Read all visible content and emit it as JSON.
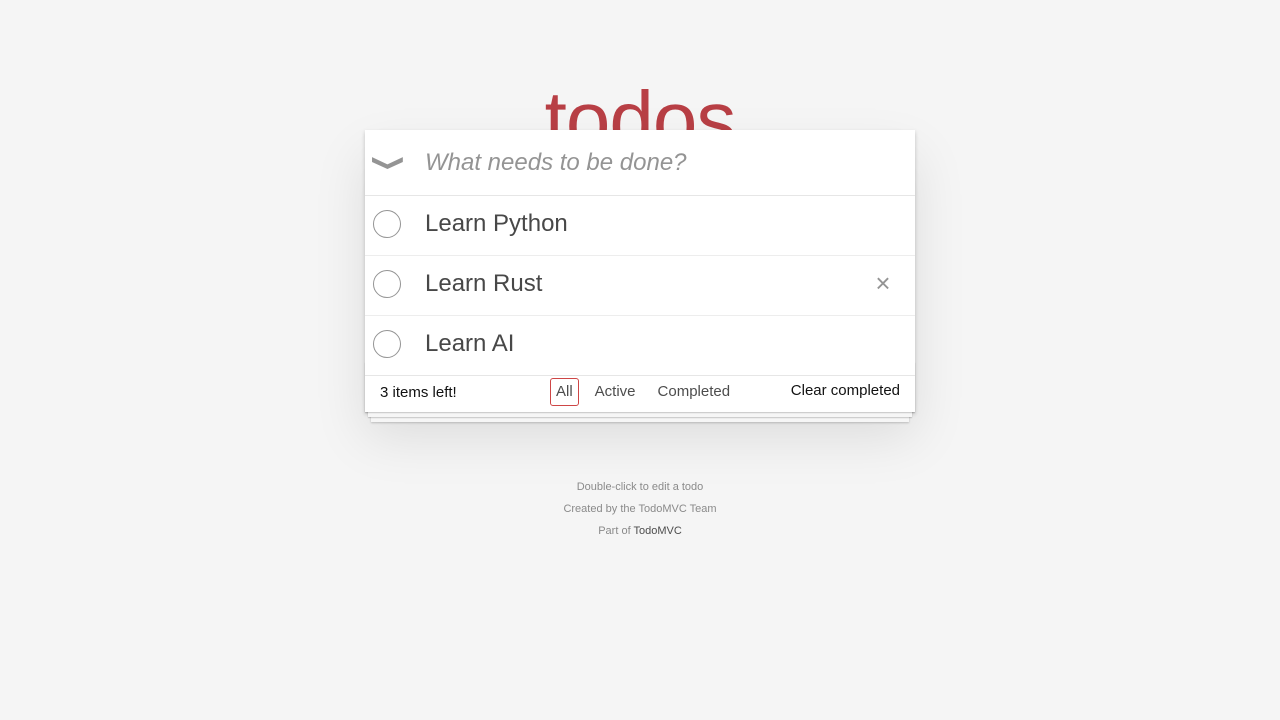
{
  "app": {
    "title": "todos"
  },
  "new_todo": {
    "placeholder": "What needs to be done?"
  },
  "toggle_all": {
    "glyph": "❯",
    "icon": "chevron-down-icon"
  },
  "todos": [
    {
      "label": "Learn Python",
      "completed": false
    },
    {
      "label": "Learn Rust",
      "completed": false,
      "hovered": true
    },
    {
      "label": "Learn AI",
      "completed": false
    }
  ],
  "destroy_glyph": "×",
  "footer": {
    "count": "3 items left!",
    "filters": [
      "All",
      "Active",
      "Completed"
    ],
    "selected_filter": "All",
    "clear_label": "Clear completed"
  },
  "info": {
    "line1": "Double-click to edit a todo",
    "line2": "Created by the TodoMVC Team",
    "line3_prefix": "Part of ",
    "line3_link": "TodoMVC"
  },
  "colors": {
    "accent": "#b83f45",
    "selected_border": "#ce4646",
    "background": "#f5f5f5"
  }
}
